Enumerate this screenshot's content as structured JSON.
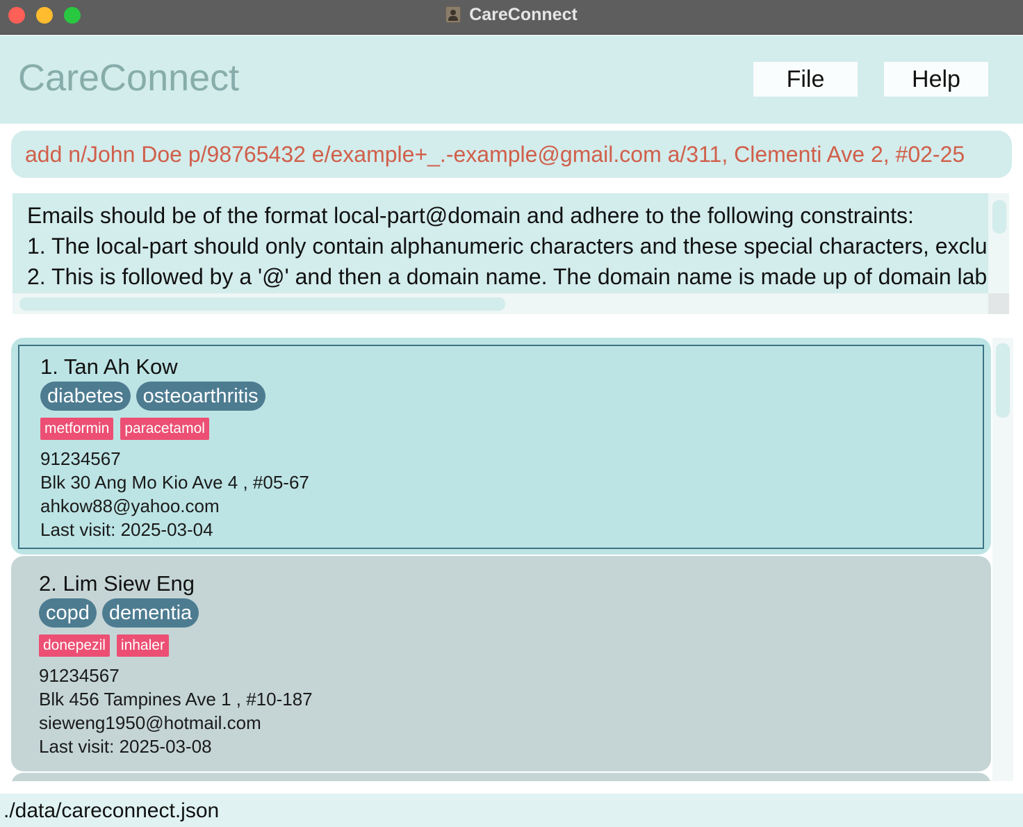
{
  "window": {
    "title": "CareConnect"
  },
  "header": {
    "brand": "CareConnect",
    "menu": {
      "file": "File",
      "help": "Help"
    }
  },
  "command": {
    "value": "add n/John Doe p/98765432 e/example+_.-example@gmail.com a/311, Clementi Ave 2, #02-25"
  },
  "result": {
    "lines": [
      "Emails should be of the format local-part@domain and adhere to the following constraints:",
      "1. The local-part should only contain alphanumeric characters and these special characters, exclu",
      "2. This is followed by a '@' and then a domain name. The domain name is made up of domain lab"
    ]
  },
  "persons": [
    {
      "index_name": "1. Tan Ah Kow",
      "conditions": [
        "diabetes",
        "osteoarthritis"
      ],
      "medications": [
        "metformin",
        "paracetamol"
      ],
      "phone": "91234567",
      "address": "Blk 30 Ang Mo Kio Ave 4 , #05-67",
      "email": "ahkow88@yahoo.com",
      "last_visit": "Last visit: 2025-03-04"
    },
    {
      "index_name": "2. Lim Siew Eng",
      "conditions": [
        "copd",
        "dementia"
      ],
      "medications": [
        "donepezil",
        "inhaler"
      ],
      "phone": "91234567",
      "address": "Blk 456 Tampines Ave 1 , #10-187",
      "email": "sieweng1950@hotmail.com",
      "last_visit": "Last visit: 2025-03-08"
    }
  ],
  "status": {
    "file_path": "./data/careconnect.json"
  },
  "colors": {
    "header_bg": "#d3ecec",
    "brand_text": "#87adab",
    "command_text": "#d05f4a",
    "tag_bg": "#4d7c91",
    "medication_bg": "#ec4f73",
    "selected_card_bg": "#bde4e4",
    "card_bg": "#c5d5d6"
  }
}
